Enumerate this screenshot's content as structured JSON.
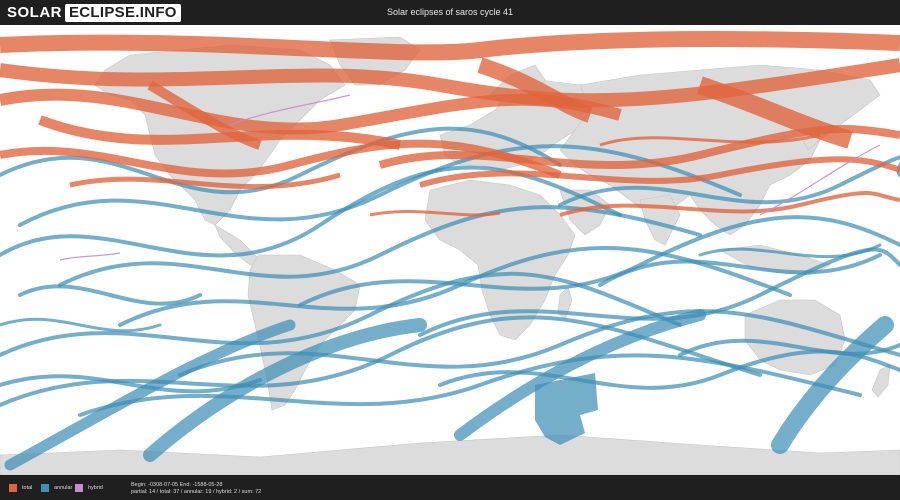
{
  "header": {
    "logo_left": "SOLAR",
    "logo_right": "ECLIPSE.INFO",
    "title": "Solar eclipses of saros cycle 41"
  },
  "colors": {
    "total": "#e0643c",
    "annular": "#3f8fb6",
    "hybrid": "#c48ccc",
    "land": "#dcdcdc",
    "ocean": "#ffffff"
  },
  "legend": [
    {
      "key": "total",
      "label": "total",
      "color": "#e0643c"
    },
    {
      "key": "annular",
      "label": "annular",
      "color": "#3f8fb6"
    },
    {
      "key": "hybrid",
      "label": "hybrid",
      "color": "#c48ccc"
    }
  ],
  "stats": {
    "range": "Begin: -0308-07-05 End: -1588-05-28",
    "counts": "partial: 14 / total: 37 / annular: 19 / hybrid: 2 / sum: 72"
  }
}
